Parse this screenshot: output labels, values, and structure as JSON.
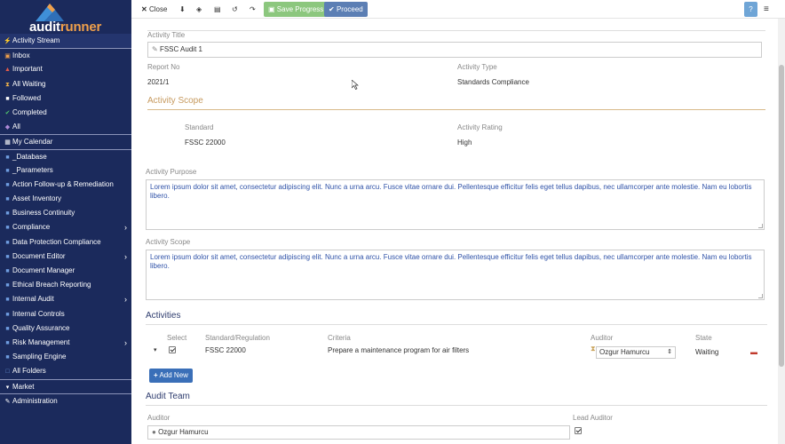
{
  "brand": {
    "name_prefix": "audit",
    "name_suffix": "runner"
  },
  "sidebar": {
    "items": [
      {
        "label": "Activity Stream",
        "icon": "bolt-icon"
      },
      {
        "label": "Inbox",
        "icon": "inbox-icon"
      },
      {
        "label": "Important",
        "icon": "warning-icon"
      },
      {
        "label": "All Waiting",
        "icon": "hourglass-icon"
      },
      {
        "label": "Followed",
        "icon": "bookmark-icon"
      },
      {
        "label": "Completed",
        "icon": "check-icon"
      },
      {
        "label": "All",
        "icon": "tag-icon"
      },
      {
        "label": "My Calendar",
        "icon": "calendar-icon"
      },
      {
        "label": "_Database",
        "icon": "folder-icon"
      },
      {
        "label": "_Parameters",
        "icon": "folder-icon"
      },
      {
        "label": "Action Follow-up & Remediation",
        "icon": "folder-icon"
      },
      {
        "label": "Asset Inventory",
        "icon": "folder-icon"
      },
      {
        "label": "Business Continuity",
        "icon": "folder-icon"
      },
      {
        "label": "Compliance",
        "icon": "folder-icon"
      },
      {
        "label": "Data Protection Compliance",
        "icon": "folder-icon"
      },
      {
        "label": "Document Editor",
        "icon": "folder-icon"
      },
      {
        "label": "Document Manager",
        "icon": "folder-icon"
      },
      {
        "label": "Ethical Breach Reporting",
        "icon": "folder-icon"
      },
      {
        "label": "Internal Audit",
        "icon": "folder-icon"
      },
      {
        "label": "Internal Controls",
        "icon": "folder-icon"
      },
      {
        "label": "Quality Assurance",
        "icon": "folder-icon"
      },
      {
        "label": "Risk Management",
        "icon": "folder-icon"
      },
      {
        "label": "Sampling Engine",
        "icon": "folder-icon"
      },
      {
        "label": "All Folders",
        "icon": "folder-open-icon"
      },
      {
        "label": "Market",
        "icon": "cart-icon"
      },
      {
        "label": "Administration",
        "icon": "wrench-icon"
      }
    ]
  },
  "toolbar": {
    "close_label": "Close",
    "save_label": "Save Progress",
    "proceed_label": "Proceed"
  },
  "form": {
    "activity_title_label": "Activity Title",
    "activity_title_value": "FSSC Audit 1",
    "report_no_label": "Report No",
    "report_no_value": "2021/1",
    "activity_type_label": "Activity Type",
    "activity_type_value": "Standards Compliance"
  },
  "scope": {
    "heading": "Activity Scope",
    "standard_label": "Standard",
    "standard_value": "FSSC 22000",
    "rating_label": "Activity Rating",
    "rating_value": "High",
    "purpose_label": "Activity Purpose",
    "purpose_text": "Lorem ipsum dolor sit amet, consectetur adipiscing elit. Nunc a urna arcu. Fusce vitae ornare dui. Pellentesque efficitur felis eget tellus dapibus, nec ullamcorper ante molestie. Nam eu lobortis libero.",
    "scope_label": "Activity Scope",
    "scope_text": "Lorem ipsum dolor sit amet, consectetur adipiscing elit. Nunc a urna arcu. Fusce vitae ornare dui. Pellentesque efficitur felis eget tellus dapibus, nec ullamcorper ante molestie. Nam eu lobortis libero."
  },
  "activities": {
    "heading": "Activities",
    "columns": [
      "Select",
      "Standard/Regulation",
      "Criteria",
      "Auditor",
      "State"
    ],
    "rows": [
      {
        "standard": "FSSC 22000",
        "criteria": "Prepare a maintenance program for air filters",
        "auditor": "Ozgur Hamurcu",
        "state": "Waiting",
        "selected": true
      }
    ],
    "add_label": "Add New"
  },
  "team": {
    "heading": "Audit Team",
    "auditor_label": "Auditor",
    "lead_label": "Lead Auditor",
    "auditor_value": "Ozgur Hamurcu",
    "lead_checked": true
  }
}
